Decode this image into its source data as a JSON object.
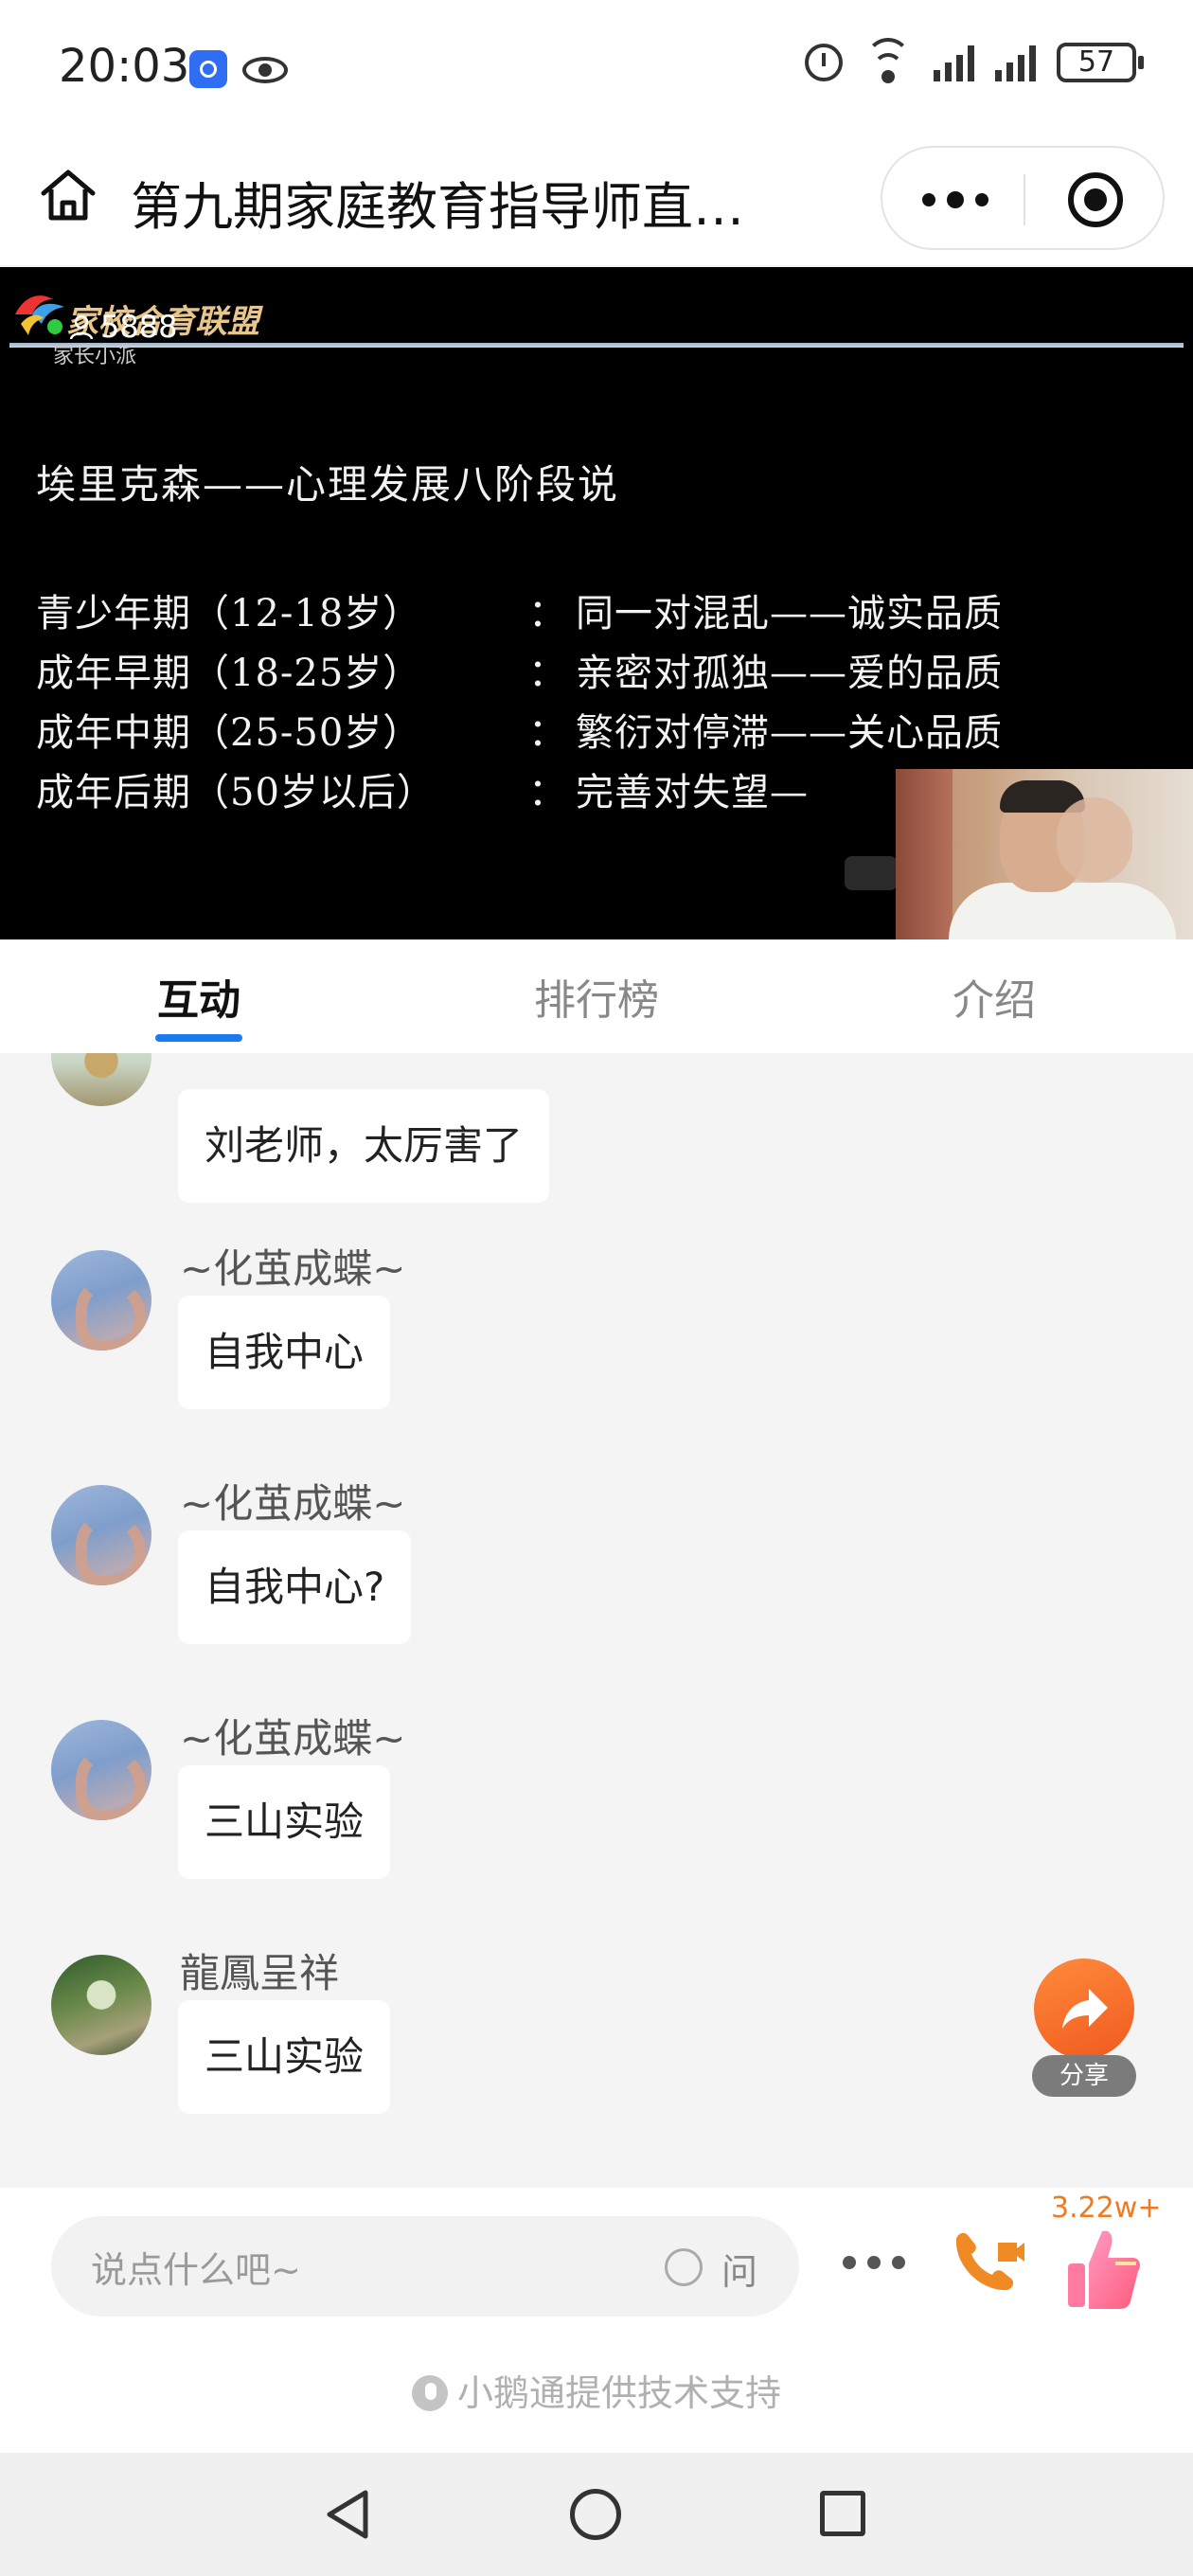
{
  "status_bar": {
    "time": "20:03",
    "battery": "57",
    "network_label": "6"
  },
  "title_bar": {
    "title": "第九期家庭教育指导师直…"
  },
  "video": {
    "logo_text": "家校合育联盟",
    "logo_sub": "家长小派",
    "viewer_count": "5888",
    "slide_title": "埃里克森——心理发展八阶段说",
    "slide_rows": [
      {
        "stage": "青少年期（12-18岁）",
        "sep": "：",
        "desc": "同一对混乱——诚实品质"
      },
      {
        "stage": "成年早期（18-25岁）",
        "sep": "：",
        "desc": "亲密对孤独——爱的品质"
      },
      {
        "stage": "成年中期（25-50岁）",
        "sep": "：",
        "desc": "繁衍对停滞——关心品质"
      },
      {
        "stage": "成年后期（50岁以后）",
        "sep": "：",
        "desc": "完善对失望—"
      }
    ]
  },
  "tabs": [
    {
      "label": "互动",
      "active": true
    },
    {
      "label": "排行榜",
      "active": false
    },
    {
      "label": "介绍",
      "active": false
    }
  ],
  "messages": [
    {
      "sender": "",
      "text": "刘老师，太厉害了",
      "avatar": "sky-avatar"
    },
    {
      "sender": "~化茧成蝶~",
      "text": "自我中心",
      "avatar": "hand-avatar"
    },
    {
      "sender": "~化茧成蝶~",
      "text": "自我中心?",
      "avatar": "hand-avatar"
    },
    {
      "sender": "~化茧成蝶~",
      "text": "三山实验",
      "avatar": "hand-avatar"
    },
    {
      "sender": "龍鳳呈祥",
      "text": "三山实验",
      "avatar": "park-avatar"
    }
  ],
  "share": {
    "label": "分享"
  },
  "input_bar": {
    "placeholder": "说点什么吧~",
    "ask_label": "问",
    "likes_count": "3.22w+",
    "powered_by": "小鹅通提供技术支持"
  },
  "colors": {
    "accent": "#1a7bf0",
    "share": "#f05a1e",
    "likes": "#f07a20",
    "phone": "#f08a24"
  }
}
